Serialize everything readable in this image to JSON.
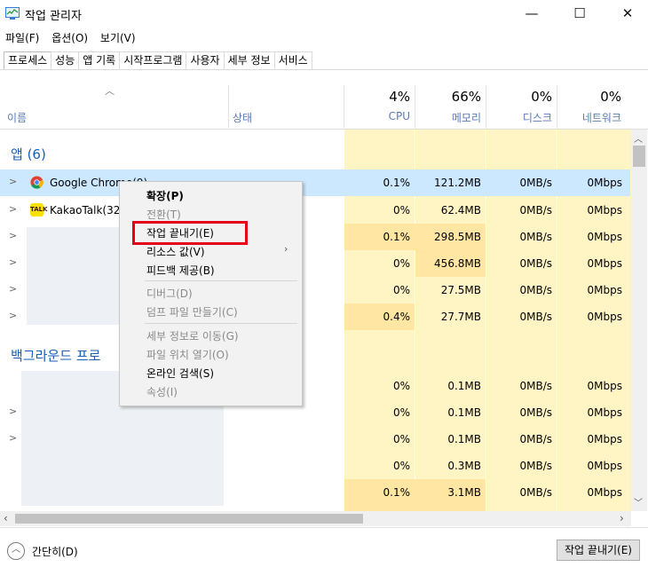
{
  "window": {
    "title": "작업 관리자",
    "minimize": "—",
    "maximize": "☐",
    "close": "✕"
  },
  "menubar": {
    "items": [
      "파일(F)",
      "옵션(O)",
      "보기(V)"
    ]
  },
  "tabs": [
    "프로세스",
    "성능",
    "앱 기록",
    "시작프로그램",
    "사용자",
    "세부 정보",
    "서비스"
  ],
  "header": {
    "name": "이름",
    "status": "상태",
    "cpu_pct": "4%",
    "cpu": "CPU",
    "mem_pct": "66%",
    "mem": "메모리",
    "disk_pct": "0%",
    "disk": "디스크",
    "net_pct": "0%",
    "net": "네트워크"
  },
  "sections": {
    "apps": "앱 (6)",
    "background": "백그라운드 프로"
  },
  "rows": [
    {
      "name": "Google Chrome(9)",
      "cpu": "0.1%",
      "mem": "121.2MB",
      "disk": "0MB/s",
      "net": "0Mbps"
    },
    {
      "name": "KakaoTalk(32",
      "cpu": "0%",
      "mem": "62.4MB",
      "disk": "0MB/s",
      "net": "0Mbps"
    },
    {
      "name": "",
      "cpu": "0.1%",
      "mem": "298.5MB",
      "disk": "0MB/s",
      "net": "0Mbps"
    },
    {
      "name": "",
      "cpu": "0%",
      "mem": "456.8MB",
      "disk": "0MB/s",
      "net": "0Mbps"
    },
    {
      "name": "",
      "cpu": "0%",
      "mem": "27.5MB",
      "disk": "0MB/s",
      "net": "0Mbps"
    },
    {
      "name": "",
      "cpu": "0.4%",
      "mem": "27.7MB",
      "disk": "0MB/s",
      "net": "0Mbps"
    }
  ],
  "bg_rows": [
    {
      "cpu": "0%",
      "mem": "0.1MB",
      "disk": "0MB/s",
      "net": "0Mbps"
    },
    {
      "cpu": "0%",
      "mem": "0.1MB",
      "disk": "0MB/s",
      "net": "0Mbps"
    },
    {
      "cpu": "0%",
      "mem": "0.1MB",
      "disk": "0MB/s",
      "net": "0Mbps"
    },
    {
      "cpu": "0%",
      "mem": "0.3MB",
      "disk": "0MB/s",
      "net": "0Mbps"
    },
    {
      "cpu": "0.1%",
      "mem": "3.1MB",
      "disk": "0MB/s",
      "net": "0Mbps"
    }
  ],
  "context_menu": {
    "expand": "확장(P)",
    "switch_to": "전환(T)",
    "end_task": "작업 끝내기(E)",
    "resource_values": "리소스 값(V)",
    "feedback": "피드백 제공(B)",
    "debug": "디버그(D)",
    "dump": "덤프 파일 만들기(C)",
    "go_details": "세부 정보로 이동(G)",
    "open_location": "파일 위치 열기(O)",
    "search_online": "온라인 검색(S)",
    "properties": "속성(I)"
  },
  "footer": {
    "fewer_details": "간단히(D)",
    "end_task_button": "작업 끝내기(E)"
  },
  "colors": {
    "accent": "#1a5fb4",
    "highlight_row": "#cce8ff",
    "heat_light": "#fff4c4",
    "heat_mid": "#ffe7a3",
    "red_box": "#e4001b"
  }
}
